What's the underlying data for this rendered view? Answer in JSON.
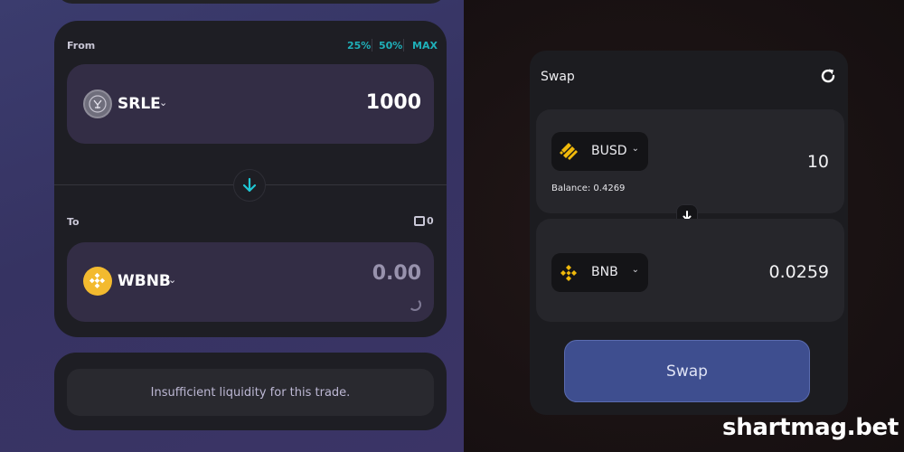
{
  "left": {
    "from_label": "From",
    "percent_buttons": [
      "25%",
      "50%",
      "MAX"
    ],
    "from_token": {
      "symbol": "SRLE",
      "amount": "1000"
    },
    "to_label": "To",
    "wallet_balance": "0",
    "to_token": {
      "symbol": "WBNB",
      "amount": "0.00"
    },
    "liquidity_message": "Insufficient liquidity for this trade.",
    "colors": {
      "accent": "#1fb0b9",
      "bnb_yellow": "#f3ba2f"
    }
  },
  "right": {
    "title": "Swap",
    "from_token": {
      "symbol": "BUSD",
      "amount": "10",
      "balance": "Balance: 0.4269",
      "icon": "busd-icon"
    },
    "to_token": {
      "symbol": "BNB",
      "amount": "0.0259",
      "icon": "bnb-icon"
    },
    "swap_button": "Swap",
    "colors": {
      "button": "#3e4e8f"
    }
  },
  "watermark": "shartmag.bet"
}
